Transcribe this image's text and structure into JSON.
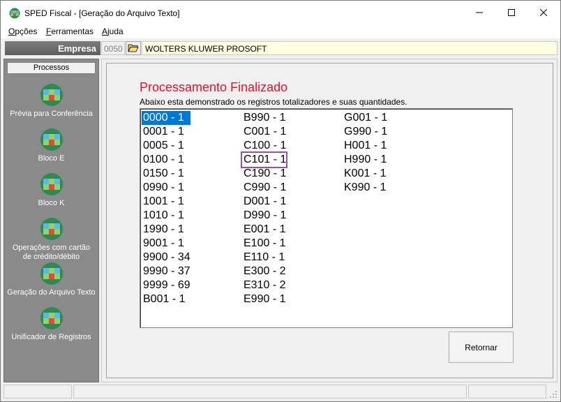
{
  "window": {
    "title": "SPED Fiscal - [Geração do Arquivo Texto]",
    "icon": "sped-logo-icon"
  },
  "menu": {
    "items": [
      {
        "first": "O",
        "rest": "pções"
      },
      {
        "first": "F",
        "rest": "erramentas"
      },
      {
        "first": "A",
        "rest": "juda"
      }
    ]
  },
  "empresa": {
    "label": "Empresa",
    "code": "0050",
    "name": "WOLTERS KLUWER PROSOFT"
  },
  "sidebar": {
    "header": "Processos",
    "items": [
      {
        "label": "Prévia para Conferência"
      },
      {
        "label": "Bloco E"
      },
      {
        "label": "Bloco K"
      },
      {
        "label": "Operações com cartão de crédito/débito"
      },
      {
        "label": "Geração do Arquivo Texto"
      },
      {
        "label": "Unificador de Registros"
      }
    ]
  },
  "main": {
    "title": "Processamento Finalizado",
    "subtitle": "Abaixo esta demonstrado os registros totalizadores e suas quantidades.",
    "columns": [
      [
        "0000 - 1",
        "0001 - 1",
        "0005 - 1",
        "0100 - 1",
        "0150 - 1",
        "0990 - 1",
        "1001 - 1",
        "1010 - 1",
        "1990 - 1",
        "9001 - 1",
        "9900 - 34",
        "9990 - 37",
        "9999 - 69",
        "B001 - 1"
      ],
      [
        "B990 - 1",
        "C001 - 1",
        "C100 - 1",
        "C101 - 1",
        "C190 - 1",
        "C990 - 1",
        "D001 - 1",
        "D990 - 1",
        "E001 - 1",
        "E100 - 1",
        "E110 - 1",
        "E300 - 2",
        "E310 - 2",
        "E990 - 1"
      ],
      [
        "G001 - 1",
        "G990 - 1",
        "H001 - 1",
        "H990 - 1",
        "K001 - 1",
        "K990 - 1"
      ]
    ],
    "selected": "0000 - 1",
    "highlighted": "C101 - 1",
    "highlight_color": "#9b4ea5",
    "title_color": "#e8102a",
    "retornar_label": "Retornar"
  }
}
